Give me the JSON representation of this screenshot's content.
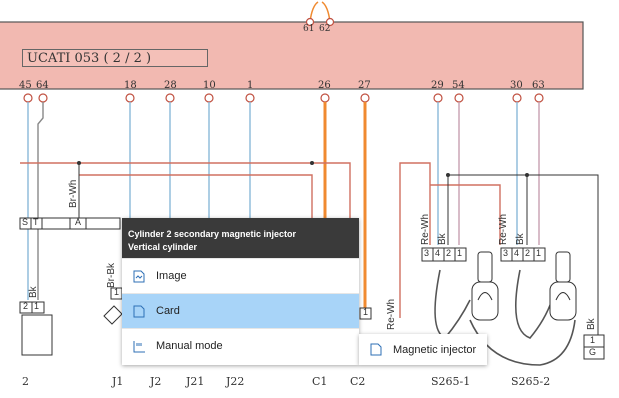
{
  "ecu": {
    "title": "UCATI 053 ( 2 / 2 )"
  },
  "top_pins": [
    "61",
    "62"
  ],
  "ecu_pins": [
    "45",
    "64",
    "18",
    "28",
    "10",
    "1",
    "26",
    "27",
    "29",
    "54",
    "30",
    "63"
  ],
  "wire_labels": [
    "Br-Wh",
    "Br-Bk",
    "Bk",
    "Re-Wh",
    "Bk",
    "Re-Wh",
    "Bk",
    "Re-Wh",
    "Bk"
  ],
  "connector_pins": {
    "left_strip": [
      "S",
      "T",
      "",
      "A"
    ],
    "left_small": [
      "2",
      "1"
    ],
    "j1": "1",
    "c2": "1",
    "s265_1": [
      "3",
      "4",
      "2",
      "1"
    ],
    "s265_2": [
      "3",
      "4",
      "2",
      "1"
    ],
    "g_box": [
      "1",
      "G"
    ]
  },
  "bottom_labels": [
    "2",
    "J1",
    "J2",
    "J21",
    "J22",
    "C1",
    "C2",
    "S265-1",
    "S265-2"
  ],
  "context_menu": {
    "header_line1": "Cylinder 2 secondary magnetic injector",
    "header_line2": "Vertical cylinder",
    "items": [
      {
        "label": "Image",
        "icon": "image-icon"
      },
      {
        "label": "Card",
        "icon": "card-icon"
      },
      {
        "label": "Manual mode",
        "icon": "manual-mode-icon"
      }
    ],
    "selected": "Card"
  },
  "submenu": {
    "label": "Magnetic injector",
    "icon": "document-icon"
  },
  "colors": {
    "ecu_fill": "#f2b9b1",
    "wire_blue": "#8ab8d8",
    "wire_orange": "#f08a30",
    "wire_red": "#d07060",
    "wire_pink": "#c8a0b0",
    "selected": "#a8d4f8"
  }
}
